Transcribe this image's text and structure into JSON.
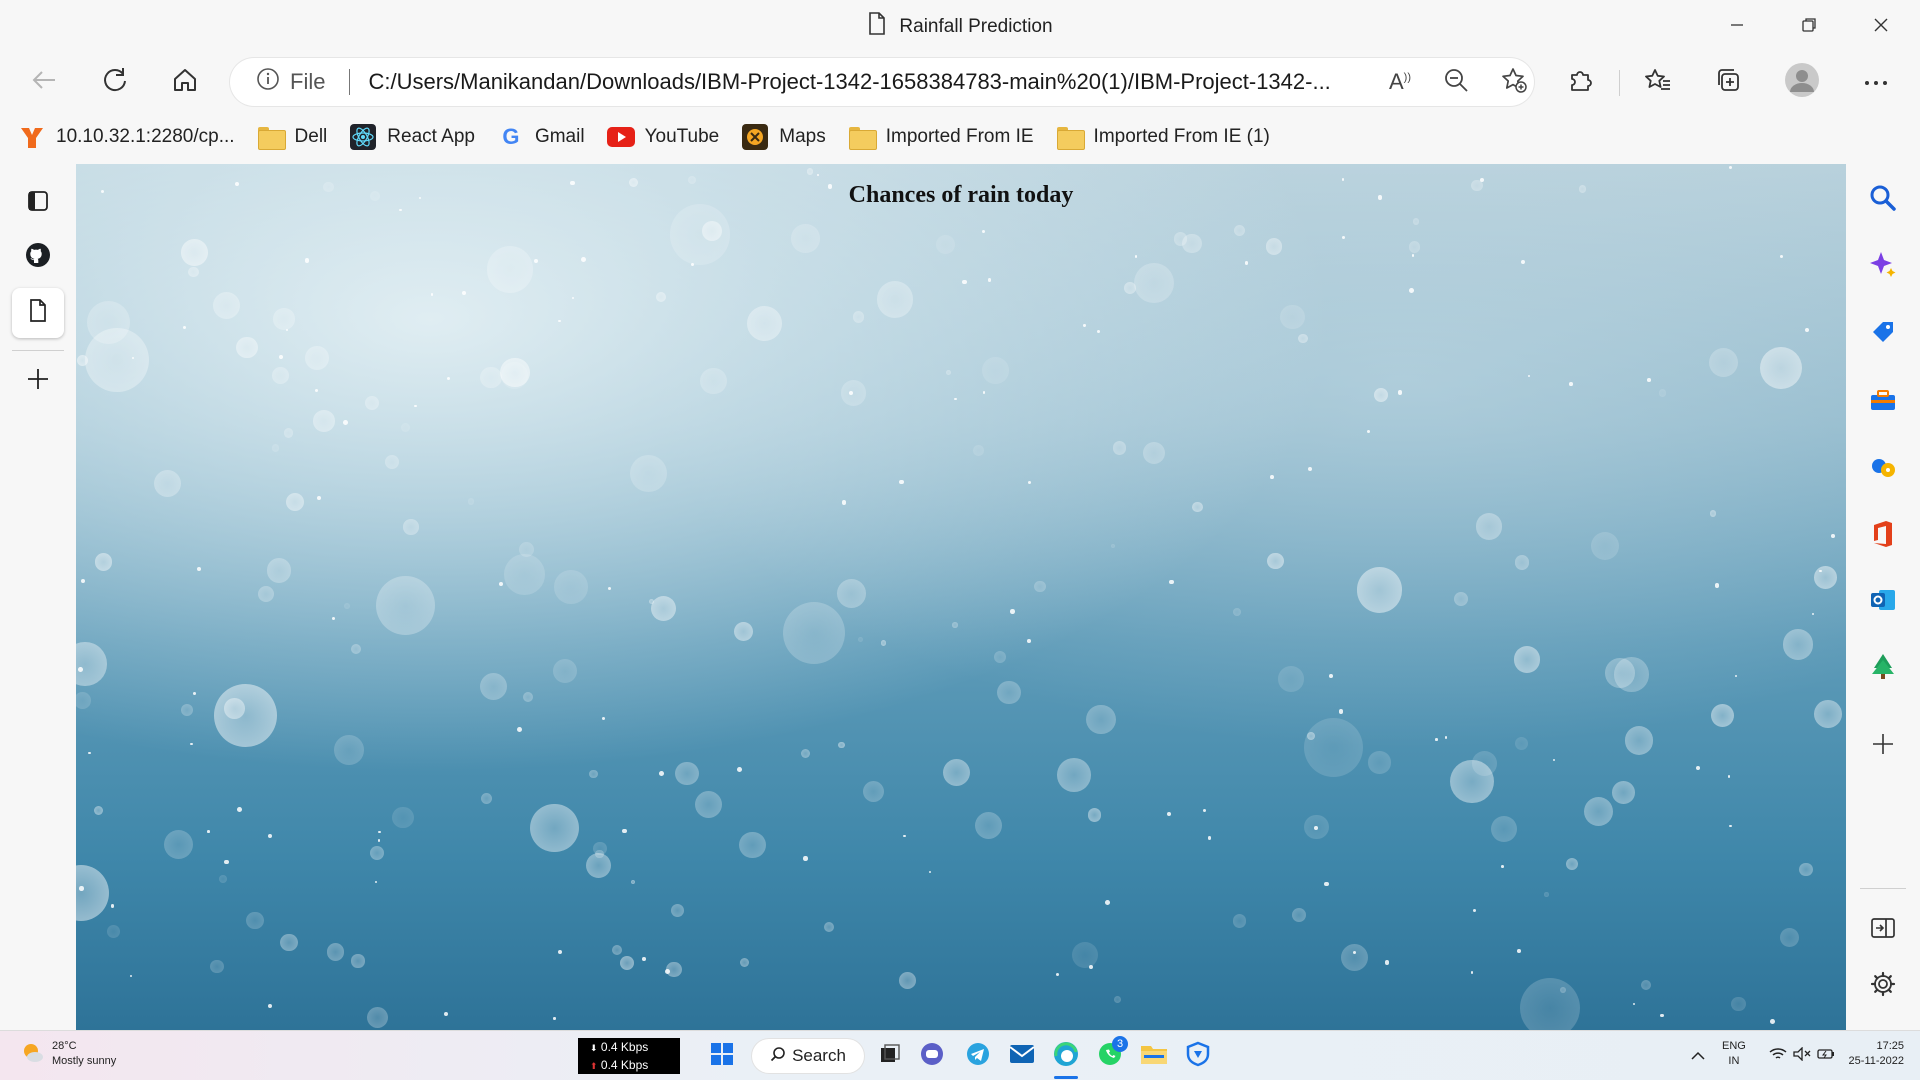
{
  "window": {
    "title": "Rainfall Prediction"
  },
  "address_bar": {
    "scheme_label": "File",
    "url": "C:/Users/Manikandan/Downloads/IBM-Project-1342-1658384783-main%20(1)/IBM-Project-1342-..."
  },
  "favorites": [
    {
      "label": "10.10.32.1:2280/cp...",
      "icon": "fortinet-icon"
    },
    {
      "label": "Dell",
      "icon": "folder-icon"
    },
    {
      "label": "React App",
      "icon": "react-icon"
    },
    {
      "label": "Gmail",
      "icon": "google-icon"
    },
    {
      "label": "YouTube",
      "icon": "youtube-icon"
    },
    {
      "label": "Maps",
      "icon": "maps-icon"
    },
    {
      "label": "Imported From IE",
      "icon": "folder-icon"
    },
    {
      "label": "Imported From IE (1)",
      "icon": "folder-icon"
    }
  ],
  "page": {
    "heading": "Chances of rain today"
  },
  "taskbar": {
    "weather": {
      "temp": "28°C",
      "condition": "Mostly sunny"
    },
    "network": {
      "down": "0.4 Kbps",
      "up": "0.4 Kbps"
    },
    "search_label": "Search",
    "whatsapp_badge": "3",
    "language": {
      "line1": "ENG",
      "line2": "IN"
    },
    "clock": {
      "time": "17:25",
      "date": "25-11-2022"
    }
  },
  "colors": {
    "accent_blue": "#1a73e8",
    "youtube_red": "#e62117",
    "folder_yellow": "#f4cc5e"
  }
}
